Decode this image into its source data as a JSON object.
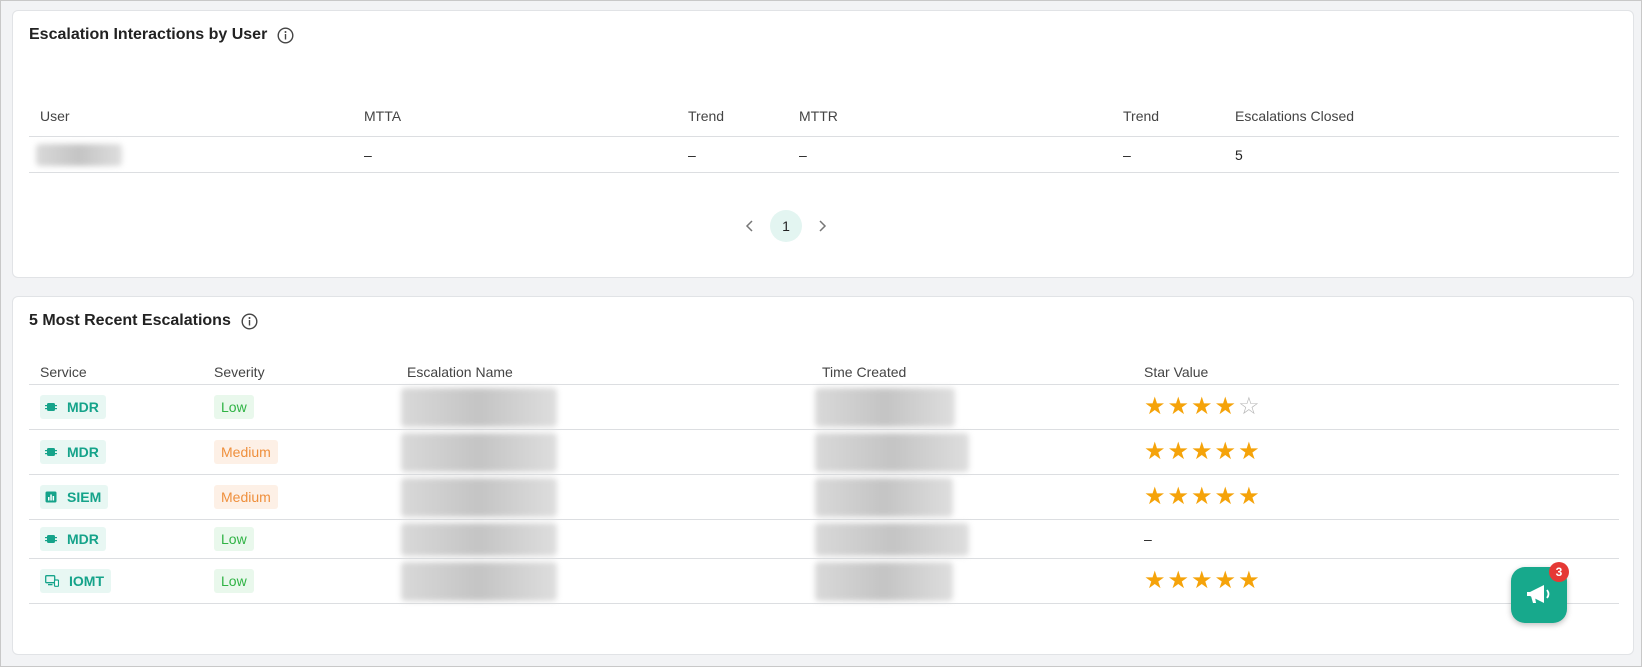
{
  "interactions": {
    "title": "Escalation Interactions by User",
    "columns": [
      "User",
      "MTTA",
      "Trend",
      "MTTR",
      "Trend",
      "Escalations Closed"
    ],
    "rows": [
      {
        "mtta": "–",
        "trend1": "–",
        "mttr": "–",
        "trend2": "–",
        "closed": "5"
      }
    ],
    "pagination": {
      "prev": "‹",
      "current": "1",
      "next": "›"
    }
  },
  "recent": {
    "title": "5 Most Recent Escalations",
    "columns": [
      "Service",
      "Severity",
      "Escalation Name",
      "Time Created",
      "Star Value"
    ],
    "rows": [
      {
        "service": "MDR",
        "service_icon": "chip-icon",
        "severity": "Low",
        "stars": 4
      },
      {
        "service": "MDR",
        "service_icon": "chip-icon",
        "severity": "Medium",
        "stars": 5
      },
      {
        "service": "SIEM",
        "service_icon": "bar-chart-icon",
        "severity": "Medium",
        "stars": 5
      },
      {
        "service": "MDR",
        "service_icon": "chip-icon",
        "severity": "Low",
        "stars": null,
        "stars_text": "–"
      },
      {
        "service": "IOMT",
        "service_icon": "device-icon",
        "severity": "Low",
        "stars": 5
      }
    ]
  },
  "fab": {
    "badge": "3",
    "icon": "megaphone-icon"
  },
  "colors": {
    "accent": "#17a98c",
    "star": "#f5a30a",
    "low": "#2fb344",
    "medium": "#ef8f3c",
    "badge": "#e53935"
  }
}
